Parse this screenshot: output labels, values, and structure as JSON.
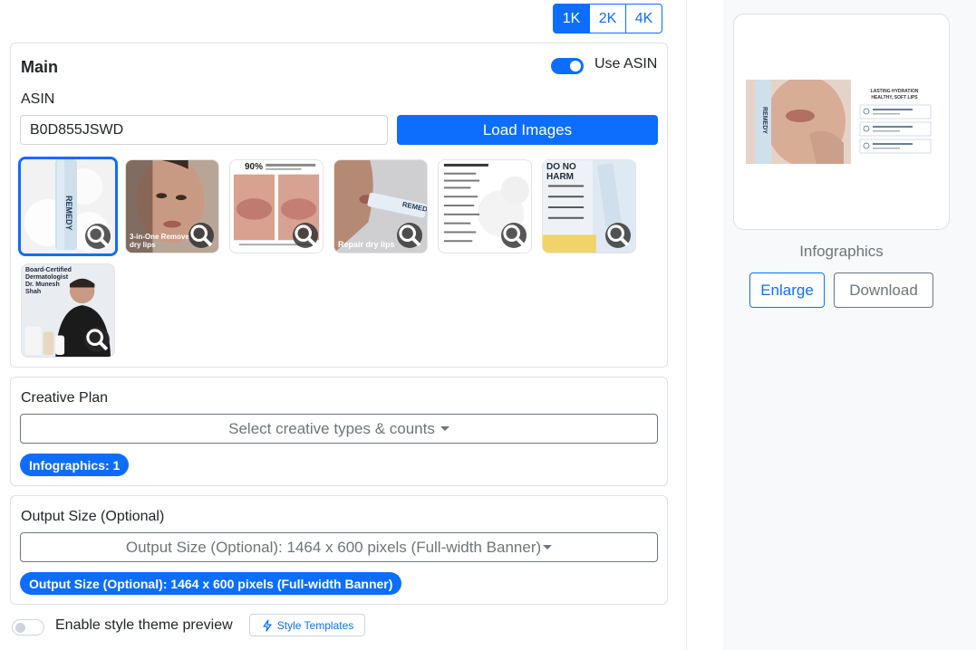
{
  "resolution": {
    "options": [
      "1K",
      "2K",
      "4K"
    ],
    "selected": "1K"
  },
  "main": {
    "title": "Main",
    "use_asin_label": "Use ASIN",
    "use_asin_enabled": true,
    "asin_label": "ASIN",
    "asin_value": "B0D855JSWD",
    "load_button": "Load Images",
    "thumbnails": [
      {
        "caption": "",
        "selected": true
      },
      {
        "caption": "3-in-One Remove dry lips",
        "selected": false
      },
      {
        "caption": "90%",
        "selected": false
      },
      {
        "caption": "Repair dry lips",
        "selected": false
      },
      {
        "caption": "",
        "selected": false
      },
      {
        "caption": "DO NO HARM",
        "selected": false
      },
      {
        "caption": "Board-Certified Dermatologist Dr. Munesh Shah",
        "selected": false
      }
    ]
  },
  "creative_plan": {
    "label": "Creative Plan",
    "dropdown_text": "Select creative types & counts",
    "pill": "Infographics: 1"
  },
  "output_size": {
    "label": "Output Size (Optional)",
    "dropdown_text": "Output Size (Optional): 1464 x 600 pixels (Full-width Banner)",
    "pill": "Output Size (Optional): 1464 x 600 pixels (Full-width Banner)"
  },
  "theme": {
    "toggle_label": "Enable style theme preview",
    "toggle_enabled": false,
    "style_templates_label": "Style Templates"
  },
  "preview": {
    "caption": "Infographics",
    "enlarge_label": "Enlarge",
    "download_label": "Download",
    "image_text": {
      "headline": "LASTING HYDRATION HEALTHY, SOFT LIPS",
      "brand": "REMEDY"
    }
  },
  "colors": {
    "primary": "#0d6efd",
    "secondary": "#6c757d",
    "panel_bg": "#f8f9fa"
  }
}
